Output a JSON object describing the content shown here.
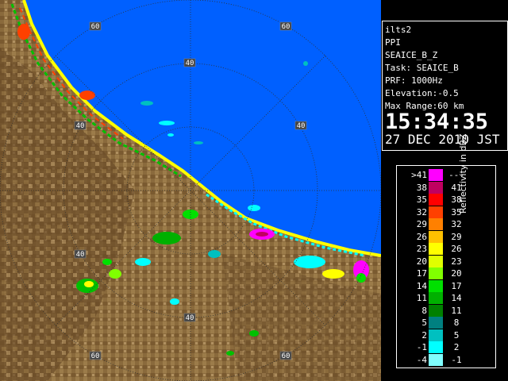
{
  "info": {
    "site": "ilts2",
    "scan_type": "PPI",
    "product": "SEAICE_B_Z",
    "task": "Task: SEAICE_B",
    "prf": "PRF: 1000Hz",
    "elevation": "Elevation:-0.5",
    "max_range": "Max Range:60 km",
    "time": "15:34:35",
    "date": "27 DEC 2010 JST"
  },
  "legend": {
    "title": "Reflectivity in dBZ",
    "rows": [
      {
        "left": ">41",
        "right": "---",
        "color": "#ff00ff"
      },
      {
        "left": "38",
        "right": "41",
        "color": "#c00060"
      },
      {
        "left": "35",
        "right": "38",
        "color": "#ff0000"
      },
      {
        "left": "32",
        "right": "35",
        "color": "#ff4000"
      },
      {
        "left": "29",
        "right": "32",
        "color": "#ff8000"
      },
      {
        "left": "26",
        "right": "29",
        "color": "#ffc000"
      },
      {
        "left": "23",
        "right": "26",
        "color": "#ffff00"
      },
      {
        "left": "20",
        "right": "23",
        "color": "#e0ff00"
      },
      {
        "left": "17",
        "right": "20",
        "color": "#80ff00"
      },
      {
        "left": "14",
        "right": "17",
        "color": "#00e000"
      },
      {
        "left": "11",
        "right": "14",
        "color": "#00b000"
      },
      {
        "left": "8",
        "right": "11",
        "color": "#008000"
      },
      {
        "left": "5",
        "right": "8",
        "color": "#008080"
      },
      {
        "left": "2",
        "right": "5",
        "color": "#00c0c0"
      },
      {
        "left": "-1",
        "right": "2",
        "color": "#00ffff"
      },
      {
        "left": "-4",
        "right": "-1",
        "color": "#80ffff"
      }
    ]
  },
  "range_labels": {
    "r40": "40",
    "r60": "60"
  },
  "colors": {
    "sea": "#0060ff",
    "land": "#8a6a3c",
    "ring": "#303030"
  }
}
